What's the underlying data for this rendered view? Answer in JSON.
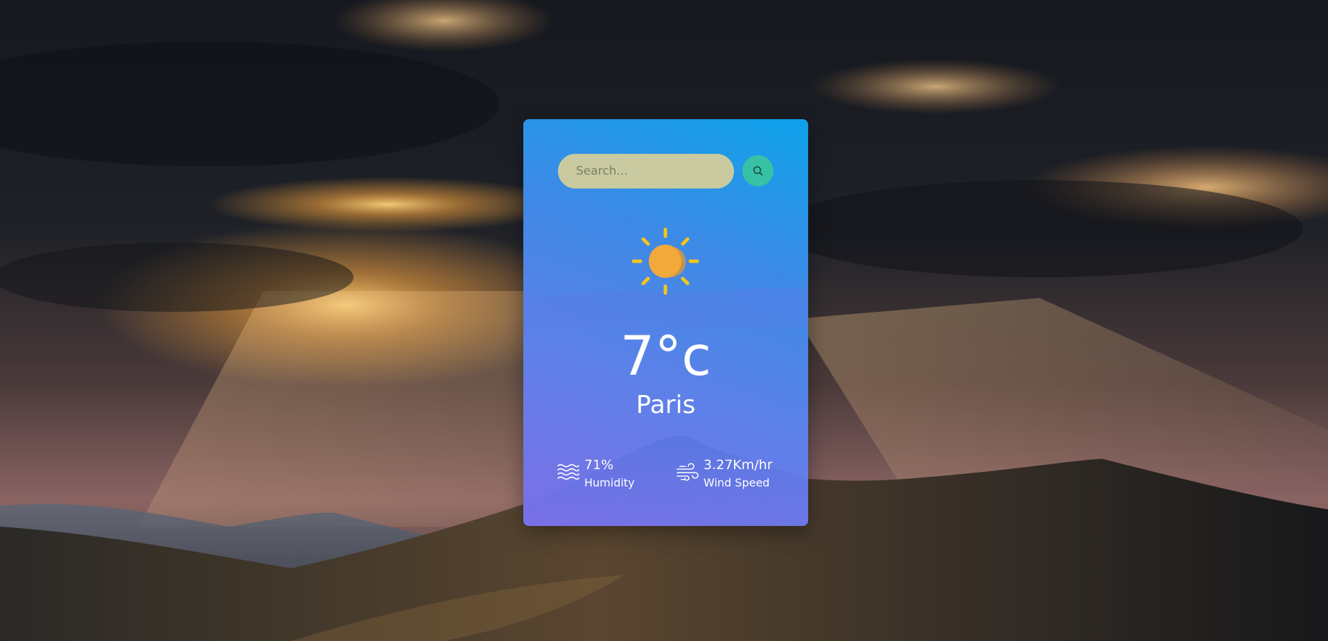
{
  "background": {
    "description_icon": "mountain-sunset-scene"
  },
  "search": {
    "placeholder": "Search...",
    "value": "",
    "button_icon": "search-icon"
  },
  "weather": {
    "icon": "sun-icon",
    "temperature": "7°c",
    "city": "Paris"
  },
  "details": {
    "humidity": {
      "icon": "waves-icon",
      "value": "71%",
      "label": "Humidity"
    },
    "wind": {
      "icon": "wind-icon",
      "value": "3.27Km/hr",
      "label": "Wind Speed"
    }
  },
  "colors": {
    "card_top": "#0ea2ea",
    "card_bottom": "#7d6fe6",
    "search_field": "#c9ca9f",
    "search_button": "#37c1a5",
    "sun": "#f2a93b",
    "sun_rays": "#f5c518"
  }
}
